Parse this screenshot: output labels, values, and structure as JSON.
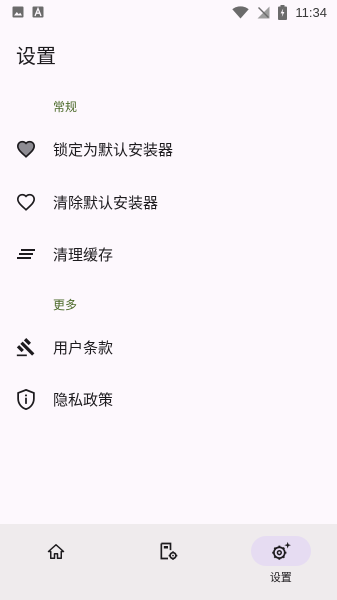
{
  "status_bar": {
    "time": "11:34",
    "left_icons": [
      "image-icon",
      "font-a-icon"
    ],
    "right_icons": [
      "wifi-icon",
      "no-signal-icon",
      "battery-charging-icon"
    ]
  },
  "page": {
    "title": "设置"
  },
  "sections": {
    "general": {
      "header": "常规",
      "items": [
        {
          "label": "锁定为默认安装器",
          "icon": "heart-filled-icon"
        },
        {
          "label": "清除默认安装器",
          "icon": "heart-outline-icon"
        },
        {
          "label": "清理缓存",
          "icon": "clear-all-icon"
        }
      ]
    },
    "more": {
      "header": "更多",
      "items": [
        {
          "label": "用户条款",
          "icon": "gavel-icon"
        },
        {
          "label": "隐私政策",
          "icon": "privacy-shield-icon"
        }
      ]
    }
  },
  "bottom_nav": {
    "items": [
      {
        "label": "",
        "icon": "home-icon",
        "active": false
      },
      {
        "label": "",
        "icon": "package-settings-icon",
        "active": false
      },
      {
        "label": "设置",
        "icon": "settings-sparkle-icon",
        "active": true
      }
    ]
  },
  "colors": {
    "background": "#fdf8fd",
    "section_header": "#4c6a2a",
    "nav_background": "#efebed",
    "active_pill": "#e6dcf2"
  }
}
